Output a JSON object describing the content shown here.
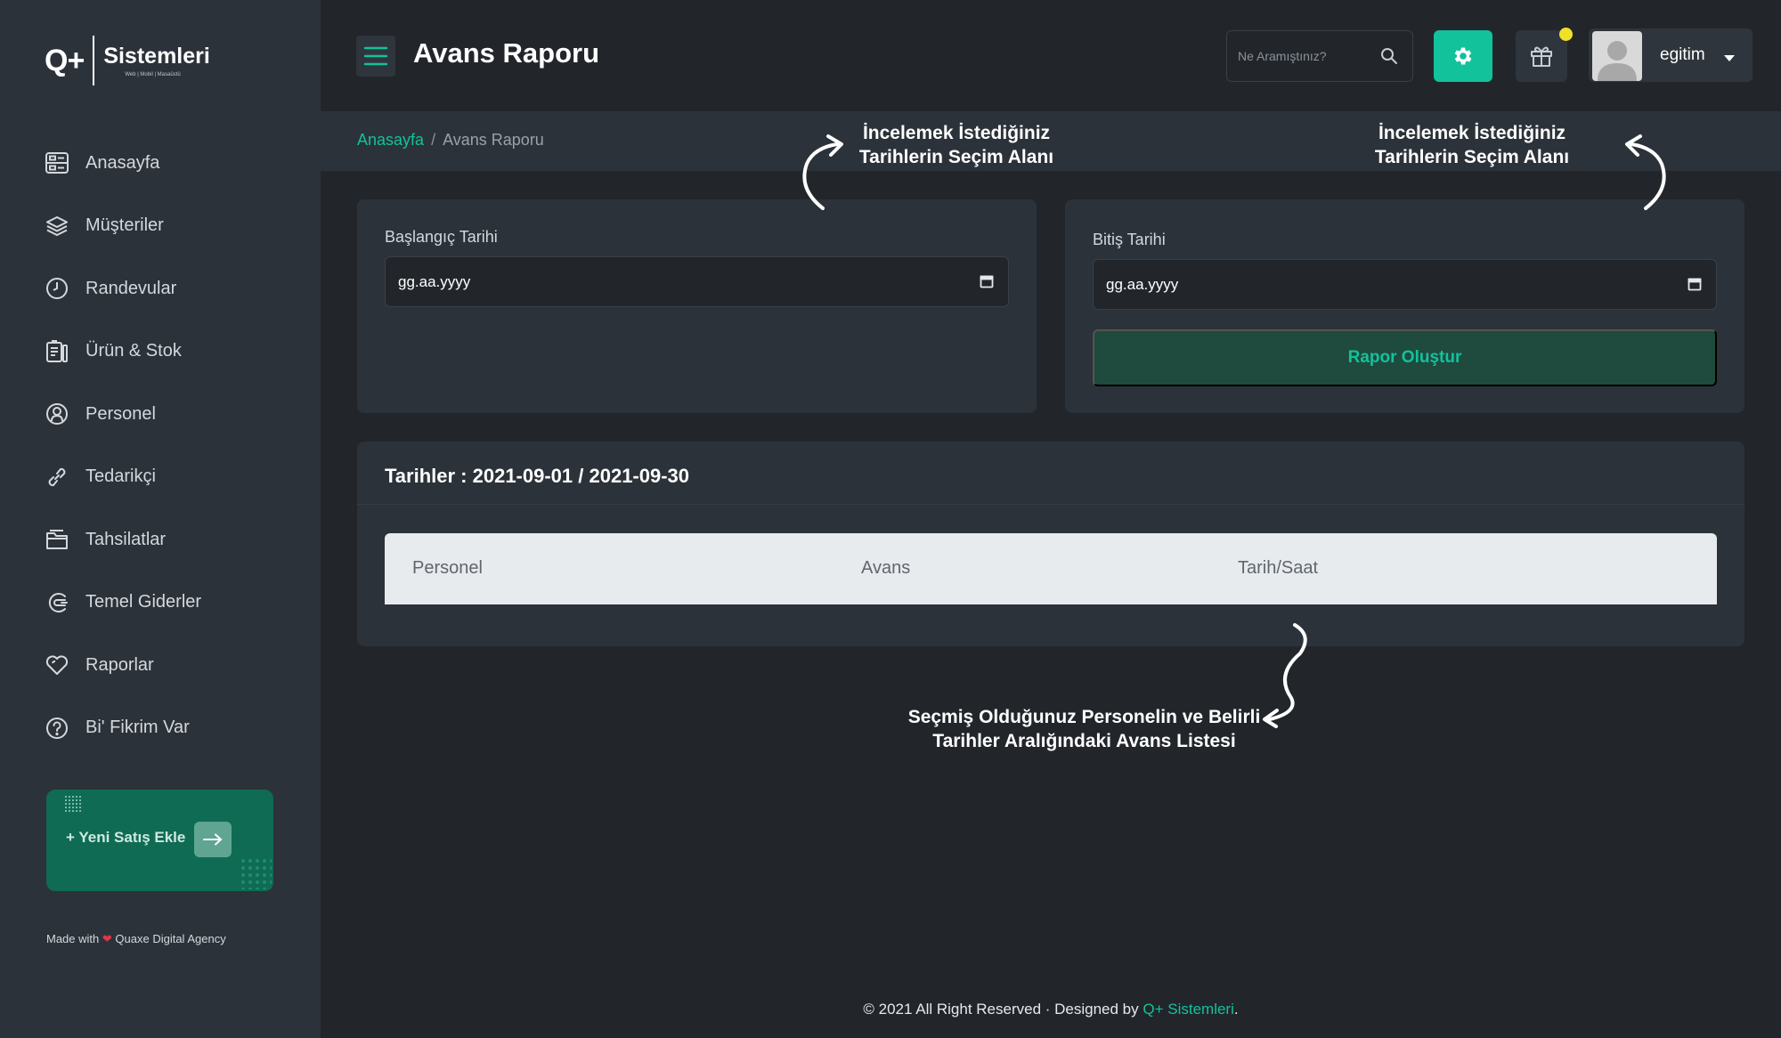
{
  "logo": {
    "mark": "Q+",
    "name": "Sistemleri",
    "tagline": "Web | Mobil | Masaüstü"
  },
  "sidebar": {
    "items": [
      {
        "label": "Anasayfa",
        "icon": "dashboard-icon"
      },
      {
        "label": "Müşteriler",
        "icon": "layers-icon"
      },
      {
        "label": "Randevular",
        "icon": "clock-icon"
      },
      {
        "label": "Ürün & Stok",
        "icon": "inventory-icon"
      },
      {
        "label": "Personel",
        "icon": "user-circle-icon"
      },
      {
        "label": "Tedarikçi",
        "icon": "link-icon"
      },
      {
        "label": "Tahsilatlar",
        "icon": "folder-icon"
      },
      {
        "label": "Temel Giderler",
        "icon": "expense-icon"
      },
      {
        "label": "Raporlar",
        "icon": "heart-icon"
      },
      {
        "label": "Bi' Fikrim Var",
        "icon": "question-icon"
      }
    ],
    "cta": {
      "label": "+ Yeni Satış Ekle"
    },
    "made_with": {
      "prefix": "Made with",
      "suffix": "Quaxe Digital Agency"
    }
  },
  "header": {
    "title": "Avans Raporu",
    "search_placeholder": "Ne Aramıştınız?",
    "username": "egitim"
  },
  "breadcrumb": {
    "home": "Anasayfa",
    "separator": "/",
    "current": "Avans Raporu"
  },
  "form": {
    "start_label": "Başlangıç Tarihi",
    "start_value": "gg.aa.yyyy",
    "end_label": "Bitiş Tarihi",
    "end_value": "gg.aa.yyyy",
    "submit_label": "Rapor Oluştur"
  },
  "result": {
    "title": "Tarihler : 2021-09-01 / 2021-09-30",
    "columns": [
      "Personel",
      "Avans",
      "Tarih/Saat"
    ]
  },
  "annotations": {
    "start_hint_line1": "İncelemek İstediğiniz",
    "start_hint_line2": "Tarihlerin Seçim Alanı",
    "end_hint_line1": "İncelemek İstediğiniz",
    "end_hint_line2": "Tarihlerin Seçim Alanı",
    "list_hint_line1": "Seçmiş Olduğunuz Personelin ve Belirli",
    "list_hint_line2": "Tarihler Aralığındaki Avans Listesi"
  },
  "footer": {
    "text": "© 2021 All Right Reserved · Designed by",
    "brand": "Q+ Sistemleri",
    "end": "."
  },
  "colors": {
    "accent": "#12c29b",
    "sidebar": "#2c3239",
    "background": "#22262b",
    "cta": "#0f6b54",
    "notification": "#f0e02a"
  }
}
